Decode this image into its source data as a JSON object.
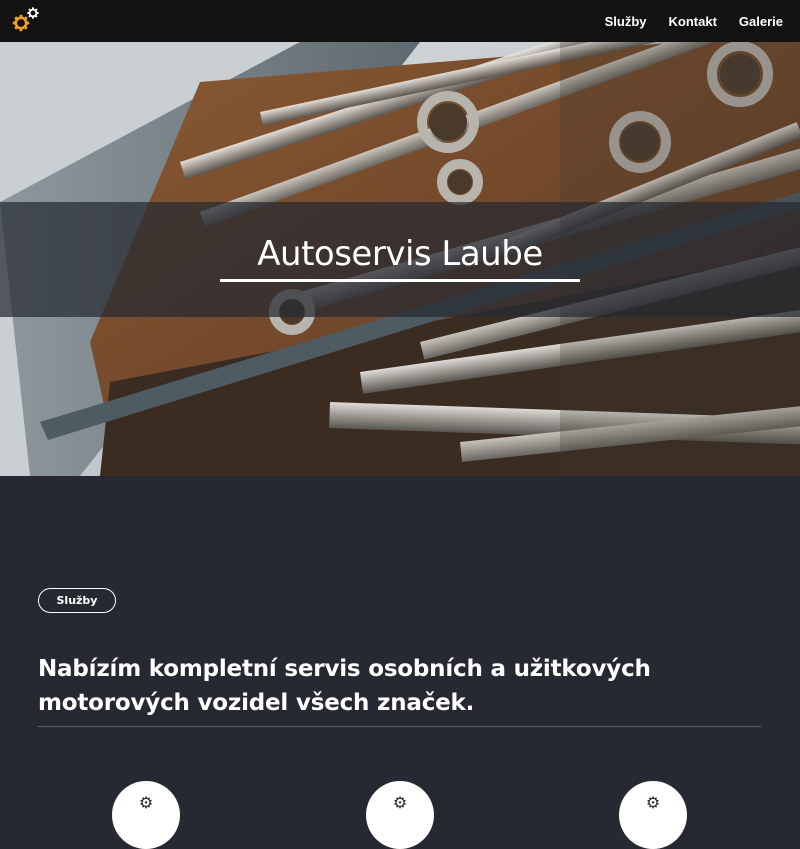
{
  "nav": {
    "logo_icon": "gears-icon",
    "links": [
      "Služby",
      "Kontakt",
      "Galerie"
    ]
  },
  "hero": {
    "title": "Autoservis Laube",
    "background": "toolbox-with-wrenches-photo"
  },
  "services": {
    "badge": "Služby",
    "heading": "Nabízím kompletní servis osobních a užitkových motorových vozidel všech značek.",
    "icons": [
      "service-icon-1",
      "service-icon-2",
      "service-icon-3"
    ]
  },
  "colors": {
    "nav_bg": "#121212",
    "page_bg": "#262932",
    "accent": "#f0a020",
    "text": "#ffffff"
  }
}
